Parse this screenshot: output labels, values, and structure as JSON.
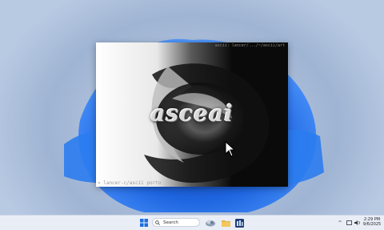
{
  "terminal": {
    "title": "ascii: lancer/.../~/ascii/art",
    "logo_text": "asceai",
    "prompt": "» lancer-c/ascii porto"
  },
  "taskbar": {
    "search_label": "Search",
    "clock_time": "2:29 PM",
    "clock_date": "9/6/2025",
    "tray_up": "^"
  },
  "colors": {
    "accent": "#1e6fe0",
    "terminal_bg": "#0a0a0a",
    "taskbar_bg": "#e9eef6"
  }
}
